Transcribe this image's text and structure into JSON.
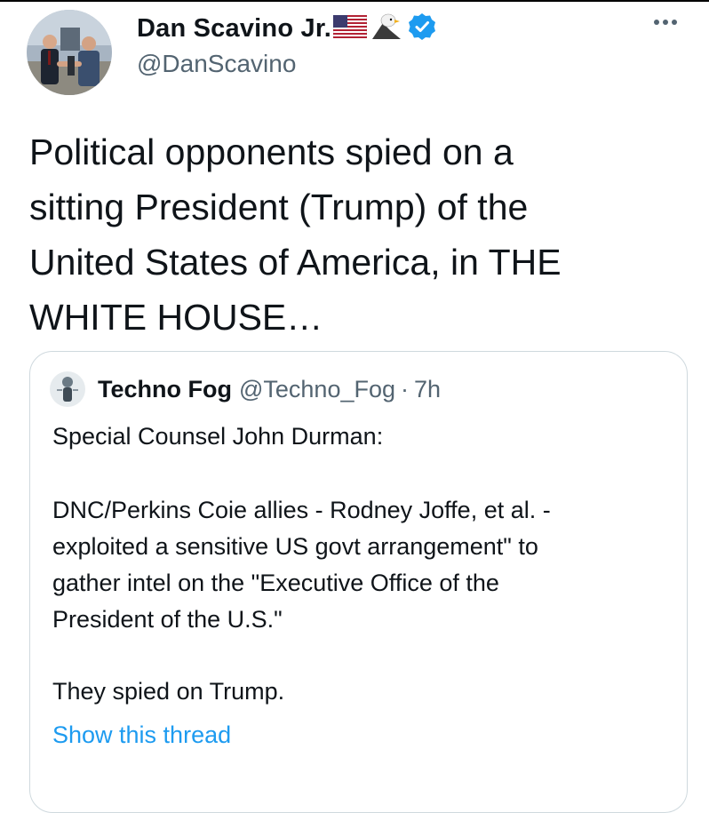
{
  "author": {
    "name": "Dan Scavino Jr.",
    "handle": "@DanScavino",
    "verified": true,
    "emojis": [
      "us-flag-icon",
      "eagle-icon"
    ]
  },
  "tweet": {
    "lines": [
      "Political opponents spied on a",
      "sitting President (Trump) of the",
      "United States of America, in THE",
      "WHITE HOUSE…"
    ]
  },
  "quoted": {
    "name": "Techno Fog",
    "handle": "@Techno_Fog",
    "separator": "·",
    "time": "7h",
    "lines": [
      "Special Counsel John Durman:",
      "DNC/Perkins Coie allies - Rodney Joffe, et al. -",
      "exploited a sensitive US govt arrangement\" to",
      "gather intel on the \"Executive Office of the",
      "President of the U.S.\"",
      "They spied on Trump."
    ],
    "show_thread": "Show this thread"
  },
  "colors": {
    "text": "#0f1419",
    "secondary": "#536471",
    "link": "#1d9bf0",
    "verified": "#1d9bf0",
    "border": "#cfd9de"
  }
}
